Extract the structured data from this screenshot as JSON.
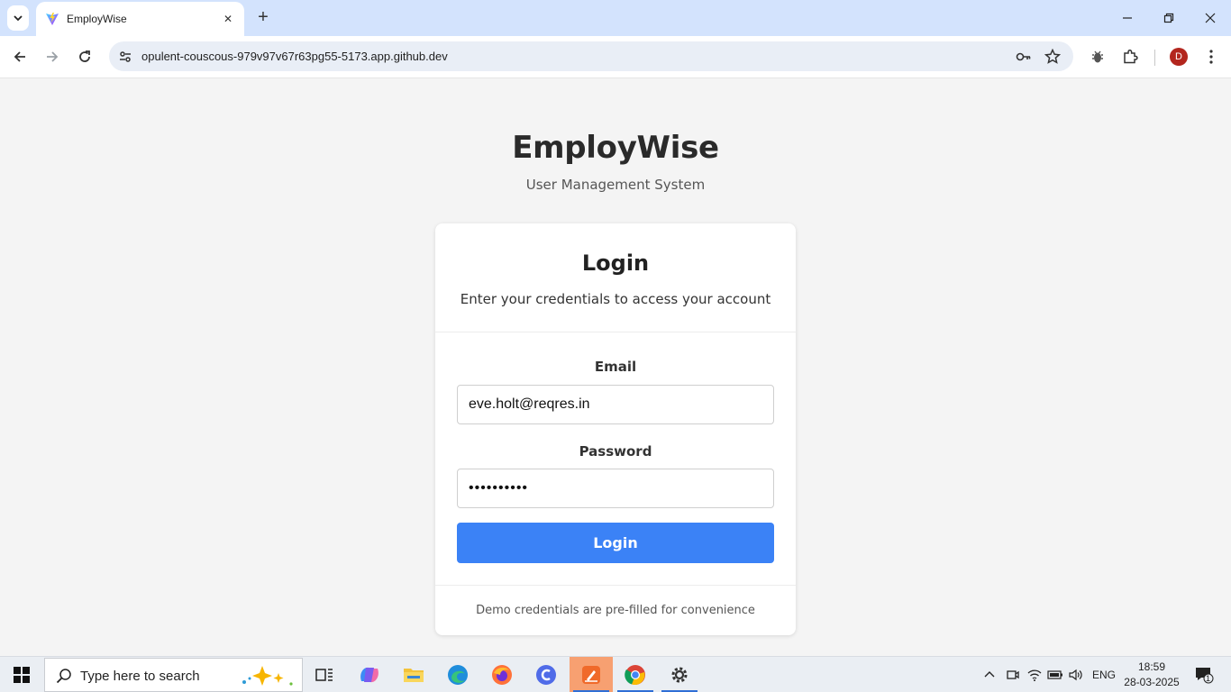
{
  "browser": {
    "tab_title": "EmployWise",
    "url": "opulent-couscous-979v97v67r63pg55-5173.app.github.dev",
    "profile_initial": "D"
  },
  "app": {
    "title": "EmployWise",
    "subtitle": "User Management System"
  },
  "login_card": {
    "title": "Login",
    "description": "Enter your credentials to access your account",
    "email_label": "Email",
    "email_value": "eve.holt@reqres.in",
    "password_label": "Password",
    "password_value": "••••••••••",
    "button_label": "Login",
    "footer_note": "Demo credentials are pre-filled for convenience"
  },
  "taskbar": {
    "search_placeholder": "Type here to search",
    "language": "ENG",
    "time": "18:59",
    "date": "28-03-2025",
    "notification_count": "1"
  },
  "colors": {
    "primary_button": "#3b82f6",
    "page_background": "#f4f4f4",
    "tabstrip": "#d3e3fd"
  }
}
